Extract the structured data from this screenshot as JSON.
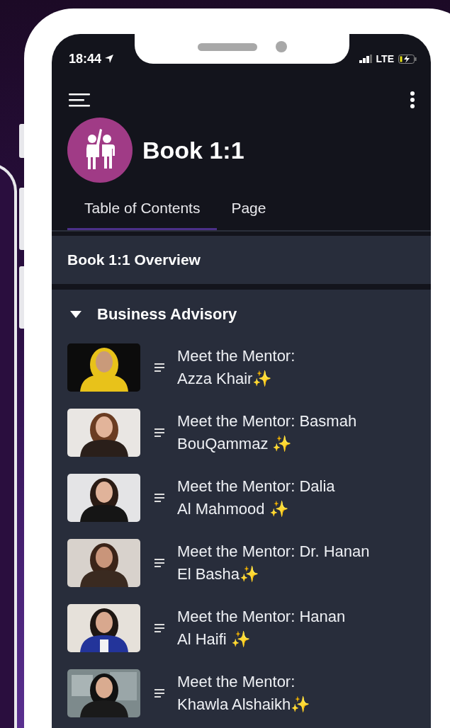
{
  "status_bar": {
    "time": "18:44",
    "network": "LTE"
  },
  "app": {
    "title": "Book 1:1"
  },
  "tabs": [
    {
      "label": "Table of Contents",
      "selected": true
    },
    {
      "label": "Page",
      "selected": false
    }
  ],
  "overview": {
    "title": "Book 1:1 Overview"
  },
  "group": {
    "title": "Business Advisory",
    "expanded": true,
    "items": [
      {
        "title": "Meet the Mentor:\nAzza Khair✨",
        "kind": "picture"
      },
      {
        "title": "Meet the Mentor: Basmah\nBouQammaz ✨",
        "kind": "picture"
      },
      {
        "title": "Meet the Mentor: Dalia\nAl Mahmood ✨",
        "kind": "picture"
      },
      {
        "title": "Meet the Mentor: Dr. Hanan\nEl Basha✨",
        "kind": "picture"
      },
      {
        "title": "Meet the Mentor: Hanan\nAl Haifi ✨",
        "kind": "picture"
      },
      {
        "title": "Meet the Mentor:\nKhawla Alshaikh✨",
        "kind": "picture"
      }
    ]
  }
}
